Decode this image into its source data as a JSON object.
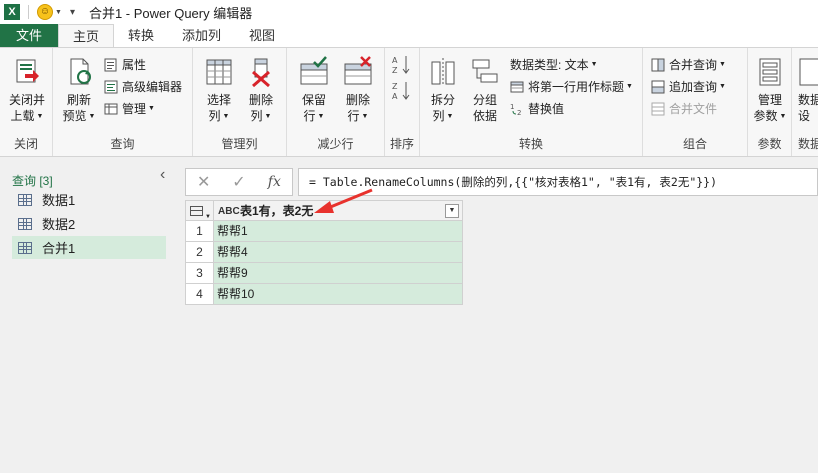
{
  "titlebar": {
    "app_logo": "X",
    "title": "合并1 - Power Query 编辑器"
  },
  "tabs": [
    {
      "label": "文件"
    },
    {
      "label": "主页"
    },
    {
      "label": "转换"
    },
    {
      "label": "添加列"
    },
    {
      "label": "视图"
    }
  ],
  "ribbon": {
    "close": {
      "btn_l1": "关闭并",
      "btn_l2": "上载",
      "group": "关闭"
    },
    "query": {
      "refresh_l1": "刷新",
      "refresh_l2": "预览",
      "properties": "属性",
      "advanced_editor": "高级编辑器",
      "manage": "管理",
      "group": "查询"
    },
    "manage_cols": {
      "choose_l1": "选择",
      "choose_l2": "列",
      "remove_l1": "删除",
      "remove_l2": "列",
      "group": "管理列"
    },
    "reduce_rows": {
      "keep_l1": "保留",
      "keep_l2": "行",
      "remove_l1": "删除",
      "remove_l2": "行",
      "group": "减少行"
    },
    "sort": {
      "group": "排序"
    },
    "transform": {
      "split_l1": "拆分",
      "split_l2": "列",
      "groupby_l1": "分组",
      "groupby_l2": "依据",
      "data_type": "数据类型: 文本",
      "first_row_header": "将第一行用作标题",
      "replace_values": "替换值",
      "group": "转换"
    },
    "combine": {
      "merge_queries": "合并查询",
      "append_queries": "追加查询",
      "combine_files": "合并文件",
      "group": "组合"
    },
    "params": {
      "manage_l1": "管理",
      "manage_l2": "参数",
      "group": "参数"
    },
    "datasource": {
      "btn_l1": "数据",
      "btn_l2": "设",
      "group": "数据"
    }
  },
  "queries": {
    "header": "查询 [3]",
    "items": [
      {
        "label": "数据1"
      },
      {
        "label": "数据2"
      },
      {
        "label": "合并1"
      }
    ]
  },
  "formula": {
    "text": "= Table.RenameColumns(删除的列,{{\"核对表格1\", \"表1有, 表2无\"}})"
  },
  "grid": {
    "column_header": "表1有，表2无",
    "type_label": "ABC",
    "rows": [
      {
        "num": "1",
        "value": "帮帮1"
      },
      {
        "num": "2",
        "value": "帮帮4"
      },
      {
        "num": "3",
        "value": "帮帮9"
      },
      {
        "num": "4",
        "value": "帮帮10"
      }
    ]
  },
  "colors": {
    "accent": "#217346",
    "selection": "#d5ebdc",
    "annotation": "#e8322d"
  }
}
